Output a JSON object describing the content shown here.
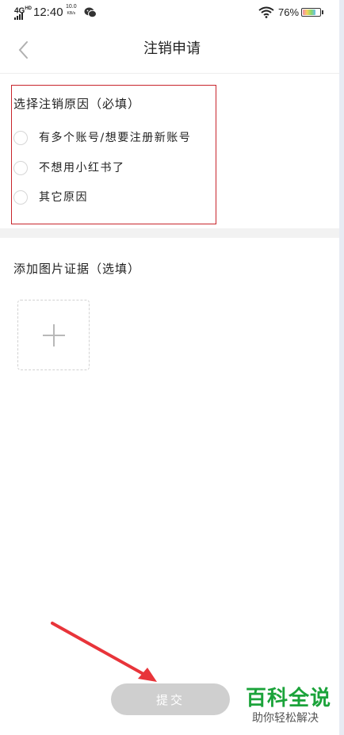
{
  "status_bar": {
    "network": "4G",
    "network_sup": "HD",
    "time": "12:40",
    "speed_value": "10.0",
    "speed_unit": "KB/s",
    "battery_percent": "76%",
    "battery_level": 0.76,
    "icons": [
      "signal-icon",
      "wechat-icon",
      "wifi-icon",
      "battery-icon"
    ]
  },
  "header": {
    "back_icon": "chevron-left-icon",
    "title": "注销申请"
  },
  "reason_section": {
    "title": "选择注销原因（必填）",
    "options": [
      {
        "label": "有多个账号/想要注册新账号",
        "selected": false
      },
      {
        "label": "不想用小红书了",
        "selected": false
      },
      {
        "label": "其它原因",
        "selected": false
      }
    ],
    "highlight_color": "#c8252c"
  },
  "evidence_section": {
    "title": "添加图片证据（选填）",
    "add_icon": "plus-icon"
  },
  "submit": {
    "label": "提交",
    "color": "#cfcfcf"
  },
  "watermark": {
    "brand": "百科全说",
    "slogan": "助你轻松解决",
    "color": "#1ba33a"
  },
  "annotation": {
    "arrow_color": "#e8343a"
  }
}
